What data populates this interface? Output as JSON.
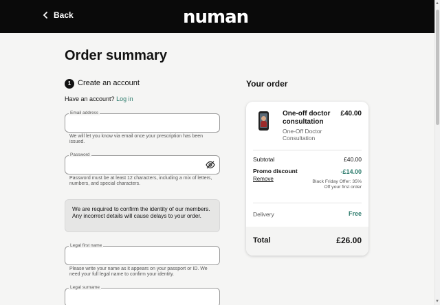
{
  "header": {
    "back_label": "Back",
    "logo_text": "numan"
  },
  "page": {
    "title": "Order summary"
  },
  "step": {
    "number": "1",
    "title": "Create an account",
    "have_account_text": "Have an account?",
    "login_link": "Log in"
  },
  "form": {
    "email": {
      "label": "Email address",
      "value": "",
      "hint": "We will let you know via email once your prescription has been issued."
    },
    "password": {
      "label": "Password",
      "value": "",
      "hint": "Password must be at least 12 characters, including a mix of letters, numbers, and special characters."
    },
    "notice": "We are required to confirm the identity of our members. Any incorrect details will cause delays to your order.",
    "first_name": {
      "label": "Legal first name",
      "value": "",
      "hint": "Please write your name as it appears on your passport or ID. We need your full legal name to confirm your identity."
    },
    "surname": {
      "label": "Legal surname",
      "value": ""
    }
  },
  "order": {
    "title": "Your order",
    "product_name": "One-off doctor consultation",
    "product_price": "£40.00",
    "product_sub": "One-Off Doctor Consultation",
    "subtotal_label": "Subtotal",
    "subtotal_value": "£40.00",
    "promo_label": "Promo discount",
    "promo_value": "-£14.00",
    "remove_label": "Remove",
    "offer_text": "Black Friday Offer: 35% Off your first order",
    "delivery_label": "Delivery",
    "delivery_value": "Free",
    "total_label": "Total",
    "total_value": "£26.00"
  },
  "colors": {
    "accent": "#2b7a6b",
    "header_bg": "#0a0a0a",
    "page_bg": "#f5f5f4"
  },
  "icons": {
    "back": "chevron-left-icon",
    "password_toggle": "eye-off-icon"
  }
}
